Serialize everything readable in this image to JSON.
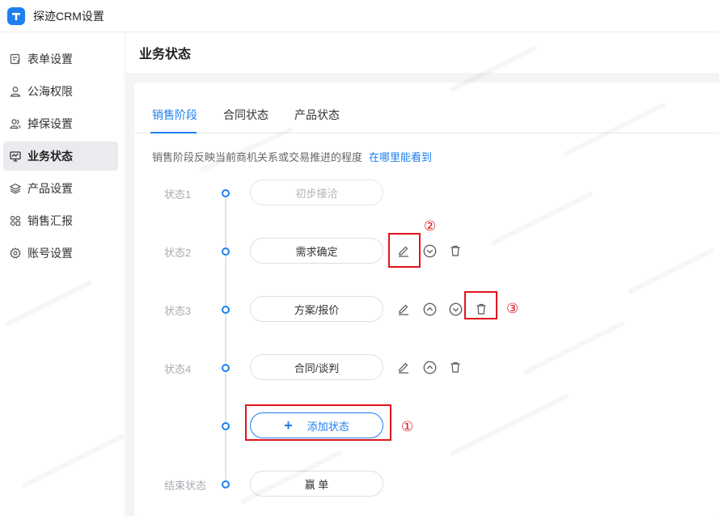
{
  "app": {
    "title": "探迹CRM设置",
    "accent_color": "#1f7ff0"
  },
  "sidebar": {
    "items": [
      {
        "label": "表单设置",
        "icon": "form-edit-icon"
      },
      {
        "label": "公海权限",
        "icon": "user-icon"
      },
      {
        "label": "掉保设置",
        "icon": "users-icon"
      },
      {
        "label": "业务状态",
        "icon": "monitor-icon",
        "active": true
      },
      {
        "label": "产品设置",
        "icon": "layers-icon"
      },
      {
        "label": "销售汇报",
        "icon": "grid-icon"
      },
      {
        "label": "账号设置",
        "icon": "gear-icon"
      }
    ]
  },
  "main": {
    "title": "业务状态",
    "tabs": [
      {
        "label": "销售阶段",
        "active": true
      },
      {
        "label": "合同状态"
      },
      {
        "label": "产品状态"
      }
    ],
    "description": "销售阶段反映当前商机关系或交易推进的程度",
    "help_link": "在哪里能看到",
    "stages": [
      {
        "label": "状态1",
        "name": "初步接洽",
        "disabled": true,
        "actions": []
      },
      {
        "label": "状态2",
        "name": "需求确定",
        "actions": [
          "edit",
          "move-down",
          "delete"
        ]
      },
      {
        "label": "状态3",
        "name": "方案/报价",
        "actions": [
          "edit",
          "move-up",
          "move-down",
          "delete"
        ]
      },
      {
        "label": "状态4",
        "name": "合同/谈判",
        "actions": [
          "edit",
          "move-up",
          "delete"
        ]
      }
    ],
    "add_button": {
      "plus": "+",
      "label": "添加状态"
    },
    "end_stage": {
      "label": "结束状态",
      "name": "赢 单"
    }
  },
  "annotations": [
    {
      "mark": "①",
      "color": "#e0141e"
    },
    {
      "mark": "②",
      "color": "#e0141e"
    },
    {
      "mark": "③",
      "color": "#e0141e"
    }
  ]
}
